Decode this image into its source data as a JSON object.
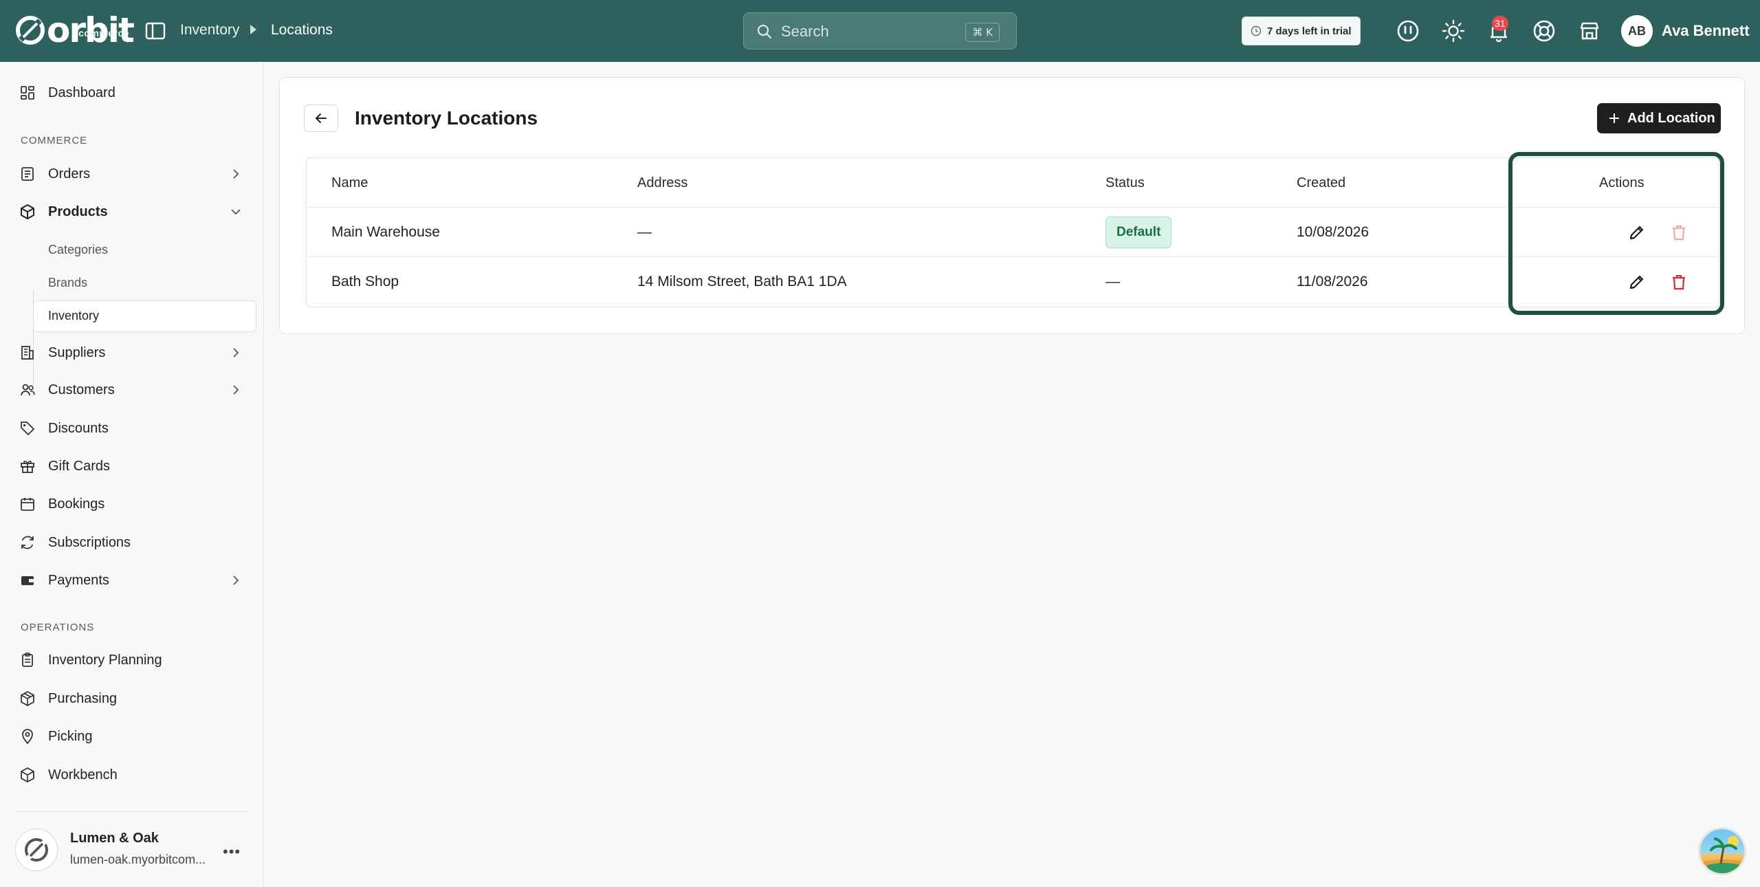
{
  "app": {
    "logo_text": "orbit",
    "logo_sub": "commerce"
  },
  "breadcrumb": {
    "items": [
      "Inventory",
      "Locations"
    ]
  },
  "search": {
    "placeholder": "Search",
    "shortcut": "⌘ K"
  },
  "trial": {
    "label": "7 days left in trial"
  },
  "notifications": {
    "count": "31"
  },
  "user": {
    "initials": "AB",
    "name": "Ava Bennett"
  },
  "sidebar": {
    "dashboard": "Dashboard",
    "section_commerce": "COMMERCE",
    "orders": "Orders",
    "products": "Products",
    "products_sub": [
      "Categories",
      "Brands",
      "Inventory"
    ],
    "suppliers": "Suppliers",
    "customers": "Customers",
    "discounts": "Discounts",
    "gift_cards": "Gift Cards",
    "bookings": "Bookings",
    "subscriptions": "Subscriptions",
    "payments": "Payments",
    "section_operations": "OPERATIONS",
    "inventory_planning": "Inventory Planning",
    "purchasing": "Purchasing",
    "picking": "Picking",
    "workbench": "Workbench"
  },
  "store": {
    "name": "Lumen & Oak",
    "url": "lumen-oak.myorbitcom..."
  },
  "page": {
    "title": "Inventory Locations",
    "add_button": "Add Location"
  },
  "table": {
    "headers": {
      "name": "Name",
      "address": "Address",
      "status": "Status",
      "created": "Created",
      "actions": "Actions"
    },
    "rows": [
      {
        "name": "Main Warehouse",
        "address": "—",
        "status": "Default",
        "created": "10/08/2026"
      },
      {
        "name": "Bath Shop",
        "address": "14 Milsom Street, Bath BA1 1DA",
        "status": "—",
        "created": "11/08/2026"
      }
    ]
  },
  "colors": {
    "topbar": "#2e615d",
    "highlight": "#1d4f45",
    "danger": "#d92d20",
    "badge_bg": "#d9f3e7"
  }
}
